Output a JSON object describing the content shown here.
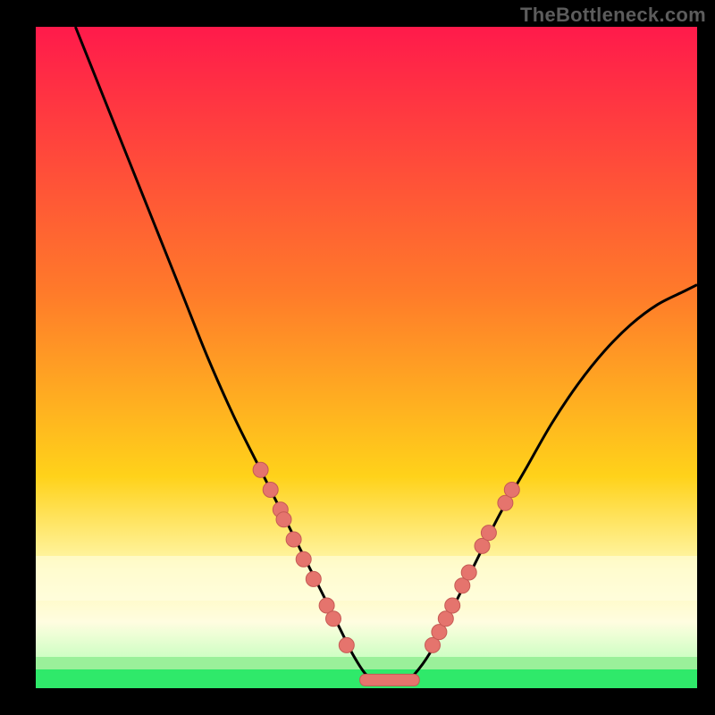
{
  "watermark": "TheBottleneck.com",
  "colors": {
    "bg_black": "#000000",
    "grad_top": "#ff1a4b",
    "grad_mid1": "#ff6a2a",
    "grad_mid2": "#ffd21a",
    "grad_haze1": "#fff8b0",
    "grad_haze2": "#fffde0",
    "grad_green": "#2fe96a",
    "curve": "#000000",
    "dot_fill": "#e5746d",
    "dot_stroke": "#c65a54"
  },
  "chart_data": {
    "type": "line",
    "title": "",
    "xlabel": "",
    "ylabel": "",
    "xlim": [
      0,
      100
    ],
    "ylim": [
      0,
      100
    ],
    "grid": false,
    "legend": false,
    "series": [
      {
        "name": "bottleneck-curve",
        "x": [
          6,
          10,
          14,
          18,
          22,
          26,
          30,
          34,
          36,
          38,
          40,
          42,
          44,
          46,
          48,
          50,
          52,
          54,
          56,
          58,
          60,
          62,
          66,
          70,
          74,
          78,
          82,
          86,
          90,
          94,
          98,
          100
        ],
        "y": [
          100,
          90,
          80,
          70,
          60,
          50,
          41,
          33,
          29,
          25,
          21,
          17,
          13,
          9,
          5,
          2,
          1,
          1,
          1,
          3,
          6,
          10,
          18,
          26,
          33,
          40,
          46,
          51,
          55,
          58,
          60,
          61
        ]
      }
    ],
    "annotations": {
      "left_cluster_dots": [
        {
          "x": 34,
          "y": 33
        },
        {
          "x": 35.5,
          "y": 30
        },
        {
          "x": 37,
          "y": 27
        },
        {
          "x": 37.5,
          "y": 25.5
        },
        {
          "x": 39,
          "y": 22.5
        },
        {
          "x": 40.5,
          "y": 19.5
        },
        {
          "x": 42,
          "y": 16.5
        },
        {
          "x": 44,
          "y": 12.5
        },
        {
          "x": 45,
          "y": 10.5
        },
        {
          "x": 47,
          "y": 6.5
        }
      ],
      "right_cluster_dots": [
        {
          "x": 60,
          "y": 6.5
        },
        {
          "x": 61,
          "y": 8.5
        },
        {
          "x": 62,
          "y": 10.5
        },
        {
          "x": 63,
          "y": 12.5
        },
        {
          "x": 64.5,
          "y": 15.5
        },
        {
          "x": 65.5,
          "y": 17.5
        },
        {
          "x": 67.5,
          "y": 21.5
        },
        {
          "x": 68.5,
          "y": 23.5
        },
        {
          "x": 71,
          "y": 28
        },
        {
          "x": 72,
          "y": 30
        }
      ],
      "valley_bar": {
        "x0": 49,
        "x1": 58,
        "y": 1.3
      }
    }
  }
}
